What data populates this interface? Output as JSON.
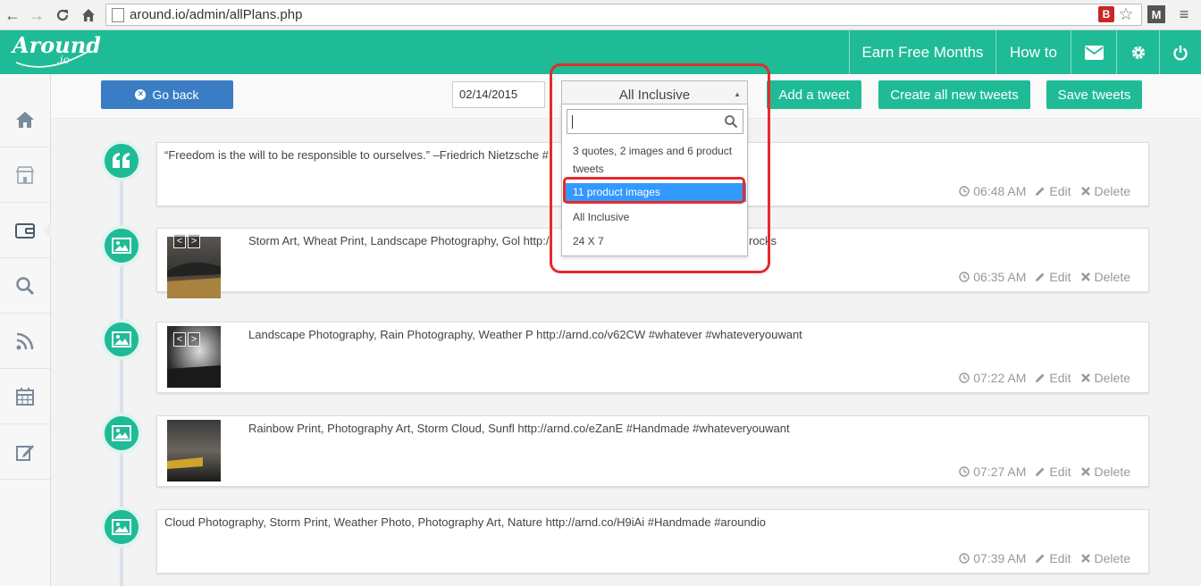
{
  "browser": {
    "url": "around.io/admin/allPlans.php"
  },
  "header": {
    "logo_main": "Around",
    "logo_sub": ".io",
    "earn_label": "Earn Free Months",
    "howto_label": "How to"
  },
  "toolbar": {
    "go_back_label": "Go back",
    "date_value": "02/14/2015",
    "selected_plan": "All Inclusive",
    "add_tweet_label": "Add a tweet",
    "create_all_label": "Create all new tweets",
    "save_label": "Save tweets"
  },
  "dropdown": {
    "search_value": "",
    "options": [
      "3 quotes, 2 images and 6 product tweets",
      "11 product images",
      "All Inclusive",
      "24 X 7"
    ],
    "highlighted": "11 product images"
  },
  "tweets": [
    {
      "type": "quote-icon",
      "text": "“Freedom is the will to be responsible to ourselves.” –Friedrich Nietzsche #",
      "time": "06:48 AM",
      "edit": "Edit",
      "delete": "Delete"
    },
    {
      "type": "image-icon",
      "text": "Storm Art, Wheat Print, Landscape Photography, Gol http:/",
      "text_tail": "rocks",
      "time": "06:35 AM",
      "edit": "Edit",
      "delete": "Delete"
    },
    {
      "type": "image-icon",
      "text": "Landscape Photography, Rain Photography, Weather P http://arnd.co/v62CW #whatever #whateveryouwant",
      "time": "07:22 AM",
      "edit": "Edit",
      "delete": "Delete"
    },
    {
      "type": "image-icon",
      "text": "Rainbow Print, Photography Art, Storm Cloud, Sunfl http://arnd.co/eZanE #Handmade #whateveryouwant",
      "time": "07:27 AM",
      "edit": "Edit",
      "delete": "Delete"
    },
    {
      "type": "image-icon",
      "text": "Cloud Photography, Storm Print, Weather Photo, Photography Art, Nature http://arnd.co/H9iAi #Handmade #aroundio",
      "time": "07:39 AM",
      "edit": "Edit",
      "delete": "Delete"
    }
  ],
  "thumb_nav": {
    "prev": "<",
    "next": ">"
  },
  "colors": {
    "brand": "#1fbb97",
    "back_button": "#3b7dc4",
    "highlight": "#3399ff",
    "annotation": "#e52b2b"
  }
}
